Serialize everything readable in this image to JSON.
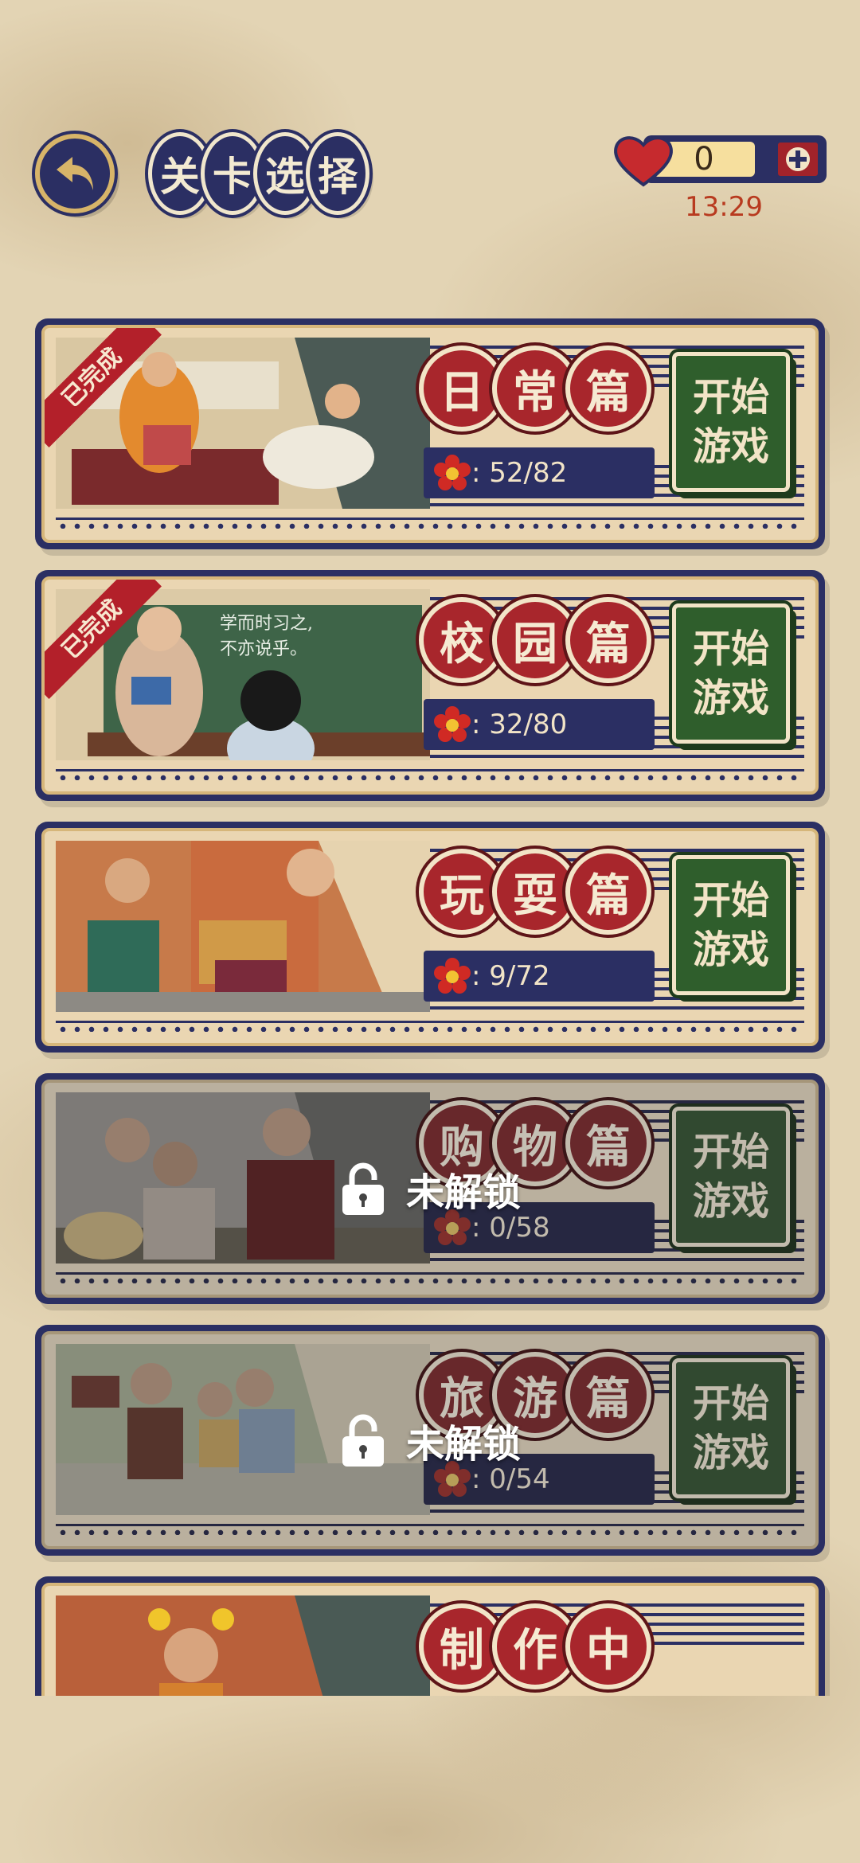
{
  "header": {
    "title_chars": [
      "关",
      "卡",
      "选",
      "择"
    ],
    "lives": "0",
    "timer": "13:29"
  },
  "levels": [
    {
      "chars": [
        "日",
        "常",
        "篇"
      ],
      "score": ": 52/82",
      "badge": "已完成",
      "start": [
        "开始",
        "游戏"
      ]
    },
    {
      "chars": [
        "校",
        "园",
        "篇"
      ],
      "score": ": 32/80",
      "badge": "已完成",
      "start": [
        "开始",
        "游戏"
      ],
      "board_text": [
        "学而时习之,",
        "不亦说乎。"
      ]
    },
    {
      "chars": [
        "玩",
        "耍",
        "篇"
      ],
      "score": ": 9/72",
      "start": [
        "开始",
        "游戏"
      ]
    },
    {
      "chars": [
        "购",
        "物",
        "篇"
      ],
      "score": ": 0/58",
      "lock": "未解锁",
      "start": [
        "开始",
        "游戏"
      ]
    },
    {
      "chars": [
        "旅",
        "游",
        "篇"
      ],
      "score": ": 0/54",
      "lock": "未解锁",
      "start": [
        "开始",
        "游戏"
      ]
    },
    {
      "chars": [
        "制",
        "作",
        "中"
      ]
    }
  ],
  "colors": {
    "navy": "#2b2f63",
    "red": "#a8262c",
    "green": "#2f5e2c",
    "cream": "#ead6b2"
  }
}
